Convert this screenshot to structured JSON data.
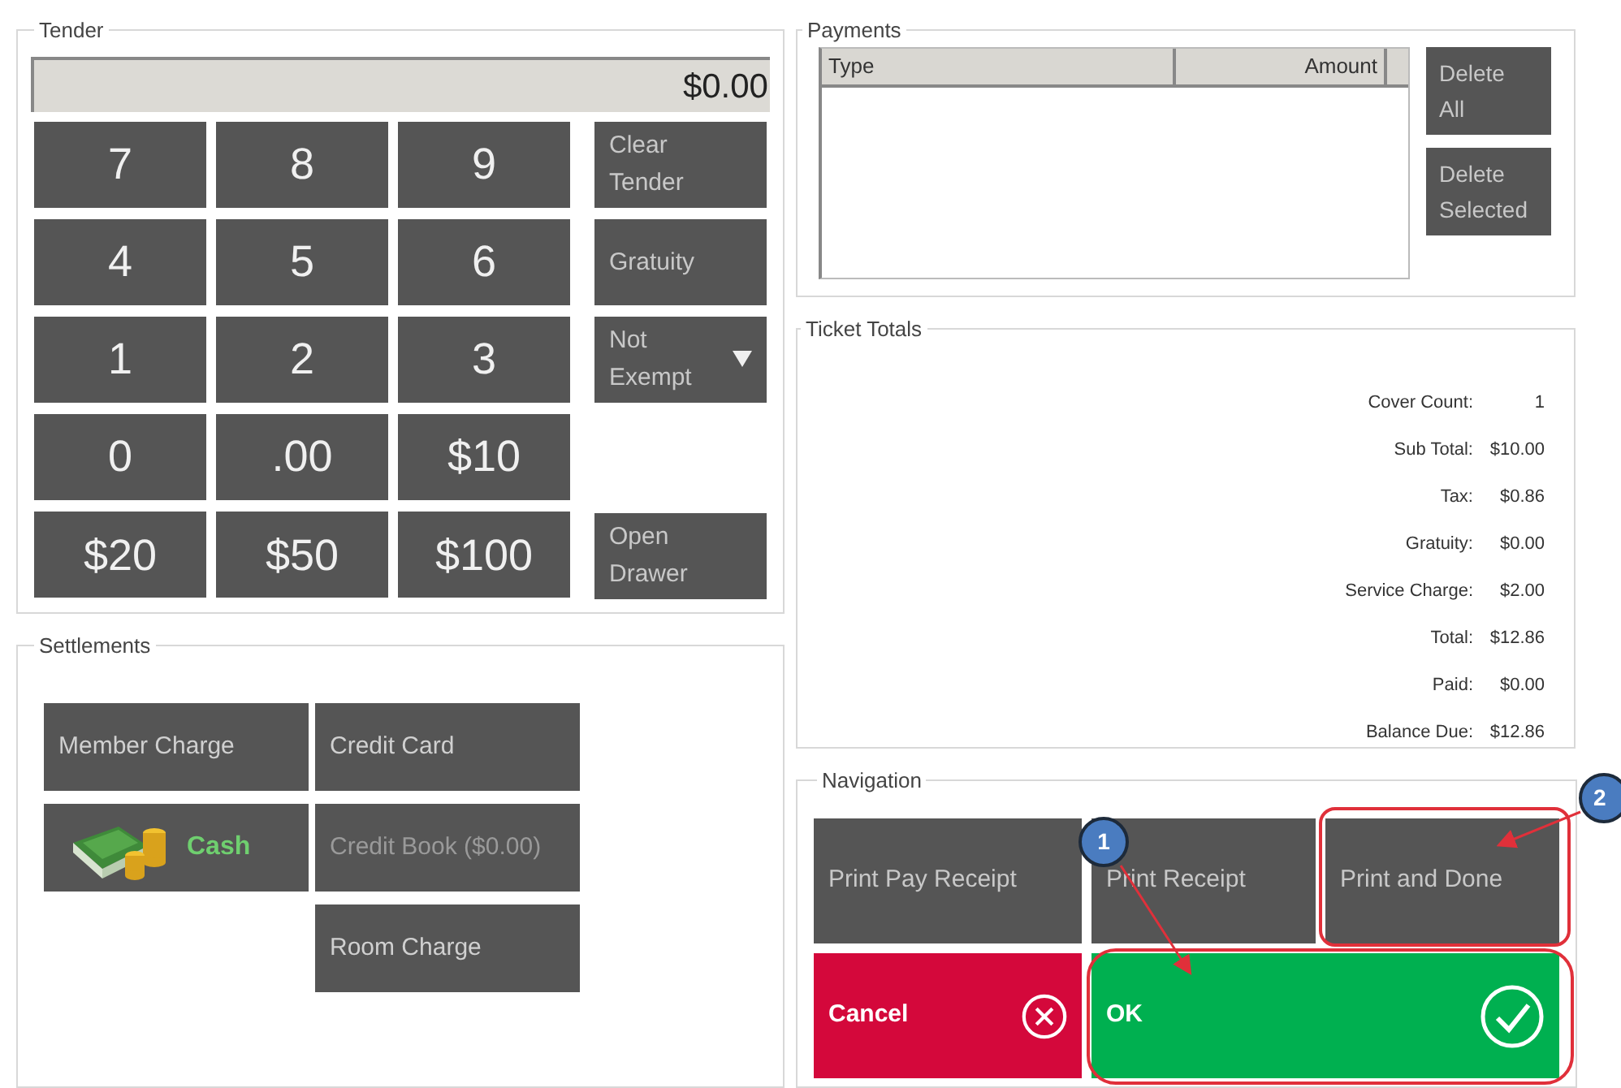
{
  "tender": {
    "title": "Tender",
    "amount": "$0.00",
    "keys": [
      "7",
      "8",
      "9",
      "4",
      "5",
      "6",
      "1",
      "2",
      "3",
      "0",
      ".00",
      "$10",
      "$20",
      "$50",
      "$100"
    ],
    "side_buttons": [
      {
        "label": "Clear Tender",
        "kind": "plain"
      },
      {
        "label": "Gratuity",
        "kind": "plain"
      },
      {
        "label": "Not Exempt",
        "kind": "dropdown"
      },
      {
        "label": "Open Drawer",
        "kind": "plain"
      }
    ]
  },
  "settlements": {
    "title": "Settlements",
    "columns": [
      [
        {
          "label": "Member Charge",
          "kind": "plain",
          "disabled": false
        },
        {
          "label": "Cash",
          "kind": "cash",
          "disabled": false
        }
      ],
      [
        {
          "label": "Credit Card",
          "kind": "plain",
          "disabled": false
        },
        {
          "label": "Credit Book ($0.00)",
          "kind": "plain",
          "disabled": true
        },
        {
          "label": "Room Charge",
          "kind": "plain",
          "disabled": false
        }
      ]
    ]
  },
  "payments": {
    "title": "Payments",
    "columns": [
      "Type",
      "Amount"
    ],
    "buttons": [
      "Delete All",
      "Delete Selected"
    ]
  },
  "ticket_totals": {
    "title": "Ticket Totals",
    "rows": [
      {
        "label": "Cover Count:",
        "value": "1"
      },
      {
        "label": "Sub Total:",
        "value": "$10.00"
      },
      {
        "label": "Tax:",
        "value": "$0.86"
      },
      {
        "label": "Gratuity:",
        "value": "$0.00"
      },
      {
        "label": "Service Charge:",
        "value": "$2.00"
      },
      {
        "label": "Total:",
        "value": "$12.86"
      },
      {
        "label": "Paid:",
        "value": "$0.00"
      },
      {
        "label": "Balance Due:",
        "value": "$12.86"
      }
    ]
  },
  "navigation": {
    "title": "Navigation",
    "buttons": [
      {
        "label": "Print Pay Receipt",
        "kind": "plain"
      },
      {
        "label": "Print Receipt",
        "kind": "plain"
      },
      {
        "label": "Print and Done",
        "kind": "plain"
      },
      {
        "label": "Cancel",
        "kind": "cancel"
      },
      {
        "label": "OK",
        "kind": "ok"
      }
    ]
  },
  "callouts": [
    {
      "label": "1"
    },
    {
      "label": "2"
    }
  ]
}
